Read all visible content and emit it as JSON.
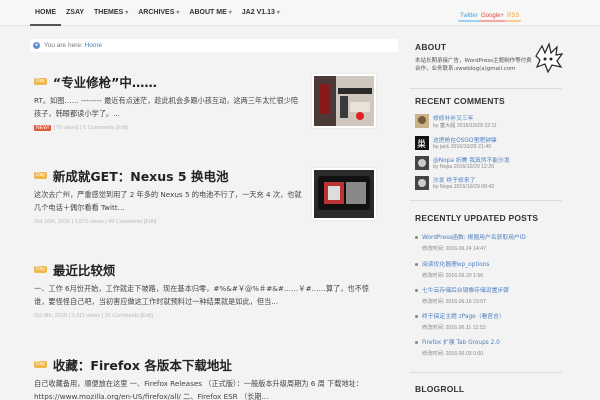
{
  "nav": {
    "items": [
      "HOME",
      "ZSAY",
      "THEMES",
      "ARCHIVES",
      "ABOUT ME",
      "JA2 V1.13"
    ],
    "has_caret": [
      false,
      false,
      true,
      true,
      true,
      true
    ],
    "social": [
      "Twitter",
      "Google+",
      "RSS"
    ]
  },
  "breadcrumb": {
    "prefix": "You are here:",
    "home": "Home"
  },
  "posts": [
    {
      "badge": "Day",
      "title": "“专业修枪”中……",
      "excerpt": "RT。如图…… -------- 最近有点迷茫，趁此机会多跟小孩互动，这两三年太忙很少陪孩子，韩眼都读小学了。...",
      "is_new": true,
      "new_label": "NEW!",
      "meta": "[76 views] | 5 Comments [Edit]"
    },
    {
      "badge": "Day",
      "title": "新成就GET：Nexus 5 换电池",
      "excerpt": "这次去广州，严重感觉到用了 2 年多的 Nexus 5 的电池不行了，一天充 4 次，也就几个电话＋偶尔看看 Twitt...",
      "is_new": false,
      "new_label": "",
      "meta": "Oct 16th, 2016 | 3,872 views | 49 Comments [Edit]"
    },
    {
      "badge": "Day",
      "title": "最近比较烦",
      "excerpt": "一、工作 6月份开始，工作就走下坡路，现在基本归零，#%&#￥@%＃#&#……￥#……算了，也不惊谁，要怪怪自己吧，当初害应做这工作时就预料过一种结果就是如此，但当...",
      "is_new": false,
      "new_label": "",
      "meta": "Oct 8th, 2016 | 3,411 views | 25 Comments [Edit]"
    },
    {
      "badge": "Day",
      "title": "收藏：Firefox 各版本下载地址",
      "excerpt": "自己收藏备用，顺便放在这里 一、Firefox Releases （正式版）：一般版本升级周期为 6 周 下载地址：https://www.mozilla.org/en-US/firefox/all/ 二、Firefox ESR （长期...",
      "is_new": false,
      "new_label": "",
      "meta": ""
    }
  ],
  "sidebar": {
    "about_title": "ABOUT",
    "about_text": "本站长期承接广告，WordPress主题制作等付费合作，业务联系:zwwblog(a)gmail.com",
    "recent_comments_title": "RECENT COMMENTS",
    "comments": [
      {
        "text": "修修补补又三年",
        "by": "by 童大超 2016/10/29 22:11"
      },
      {
        "text": "这把枪在OSGO里肥钟锋",
        "by": "by jack 2016/10/29 21:40"
      },
      {
        "text": "@Nopa 折腾 我真然不能沙发",
        "by": "by Nopa 2016/10/29 12:26"
      },
      {
        "text": "沙发 终于修来了",
        "by": "by Nopa 2016/10/29 08:42"
      }
    ],
    "recent_posts_title": "RECENTLY UPDATED POSTS",
    "recent_posts": [
      {
        "title": "WordPress函数: 根据用户名获取用户ID",
        "date": "修改时间: 2016.06.24 14:47"
      },
      {
        "title": "阅读优化器理wp_options",
        "date": "修改时间: 2016.06.20 1:56"
      },
      {
        "title": "七牛云存储后台镜像存储设置步骤",
        "date": "修改时间: 2016.06.16 23:07"
      },
      {
        "title": "终于搞定主题 zPage（看官吉）",
        "date": "修改时间: 2016.06.11 12:53"
      },
      {
        "title": "Firefox 扩展 Tab Groups 2.0",
        "date": "修改时间: 2016.06.03 0:00"
      }
    ],
    "blogroll_title": "BLOGROLL"
  },
  "colors": {
    "accent": "#4a7fc1",
    "badge": "#f0b64a",
    "new": "#e2583c",
    "background": "#f3f3f3"
  }
}
